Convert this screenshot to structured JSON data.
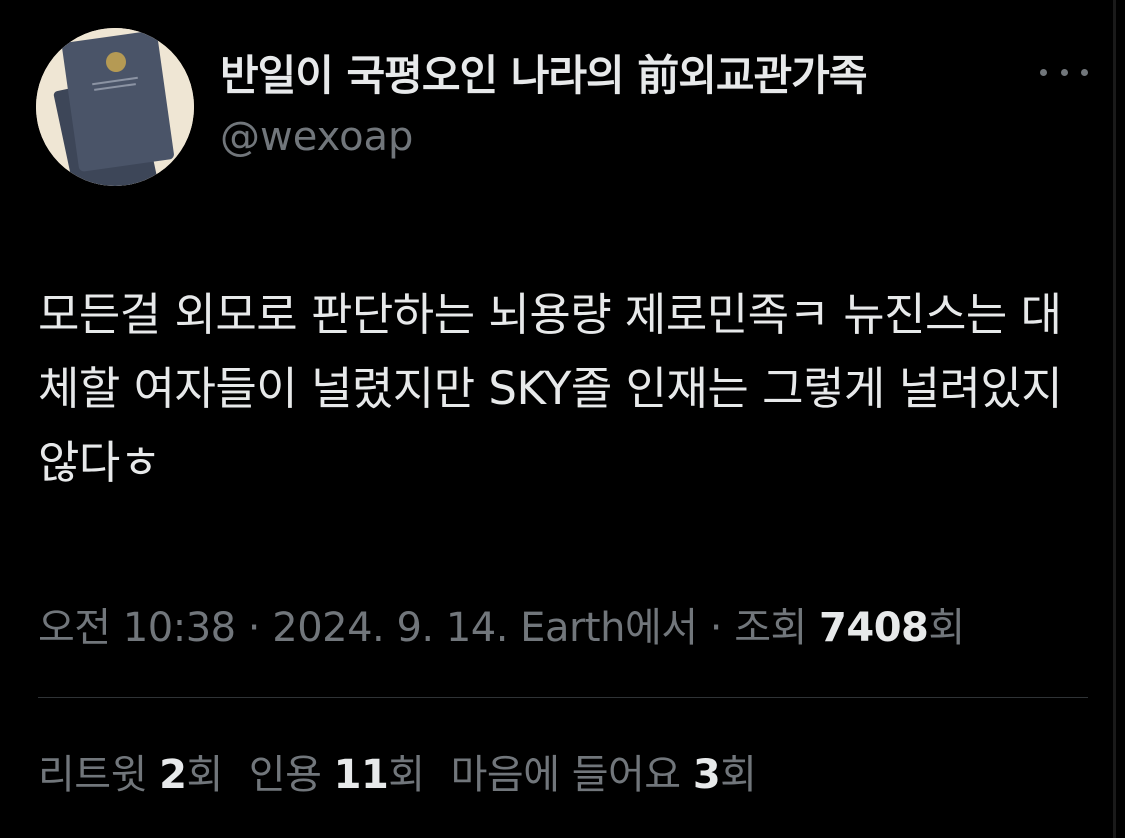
{
  "author": {
    "display_name": "반일이 국평오인 나라의 前외교관가족",
    "handle": "@wexoap",
    "avatar_icon": "passport-avatar-icon"
  },
  "more_icon": "more-dots-icon",
  "tweet": {
    "text": "모든걸 외모로 판단하는 뇌용량 제로민족ㅋ 뉴진스는 대체할 여자들이 널렸지만 SKY졸 인재는 그렇게 널려있지않다ㅎ"
  },
  "meta": {
    "time": "오전 10:38",
    "sep1": " · ",
    "date": "2024. 9. 14.",
    "source": " Earth에서",
    "sep2": " · ",
    "views_label": "조회 ",
    "views_count": "7408",
    "views_suffix": "회"
  },
  "stats": {
    "retweets_label": "리트윗 ",
    "retweets_count": "2",
    "retweets_suffix": "회",
    "quotes_label": "인용 ",
    "quotes_count": "11",
    "quotes_suffix": "회",
    "likes_label": "마음에 들어요 ",
    "likes_count": "3",
    "likes_suffix": "회"
  },
  "colors": {
    "background": "#000000",
    "primary_text": "#e7e9ea",
    "secondary_text": "#71767b",
    "divider": "#2f3336"
  }
}
